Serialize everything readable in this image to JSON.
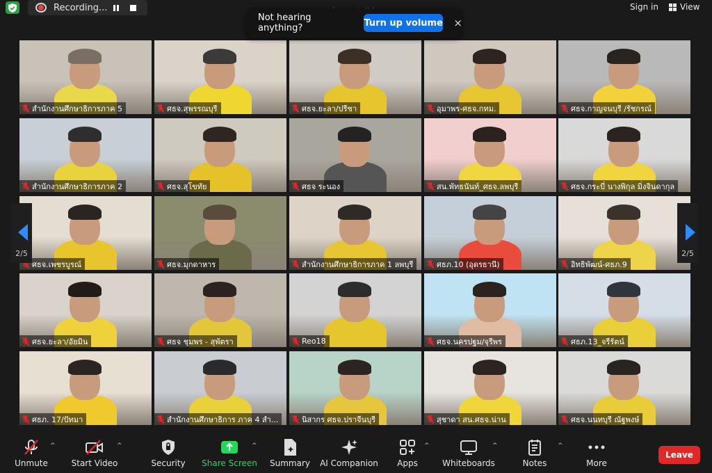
{
  "topbar": {
    "recording_label": "Recording...",
    "speaking_text": "กพร.สป.ศธ.ว. talking...",
    "signin_label": "Sign in",
    "view_label": "View"
  },
  "toast": {
    "message": "Not hearing anything?",
    "button_label": "Turn up volume",
    "close_glyph": "×"
  },
  "pager": {
    "left_page": "2/5",
    "right_page": "2/5"
  },
  "participants": [
    {
      "name": "สำนักงานศึกษาธิการภาค 5"
    },
    {
      "name": "ศธจ.สุพรรณบุรี"
    },
    {
      "name": "ศธจ.ยะลา/ปรีชา"
    },
    {
      "name": "อุมาพร-ศธจ.กทม."
    },
    {
      "name": "ศธจ.กาญจนบุรี /รัชกรณ์"
    },
    {
      "name": "สำนักงานศึกษาธิการภาค 2"
    },
    {
      "name": "ศธจ.สุโขทัย"
    },
    {
      "name": "ศธจ ระนอง"
    },
    {
      "name": "สน.พัทธนันท์_ศธจ.ลพบุรี"
    },
    {
      "name": "ศธจ.กระบี่ นางพิกุล มิ่งจินดากุล"
    },
    {
      "name": "ศธจ.เพชรบูรณ์"
    },
    {
      "name": "ศธจ.มุกดาหาร"
    },
    {
      "name": "สำนักงานศึกษาธิการภาค 1 ลพบุรี"
    },
    {
      "name": "ศธภ.10 (อุดรธานี)"
    },
    {
      "name": "อิทธิพัฒน์-ศธภ.9"
    },
    {
      "name": "ศธจ.ยะลา/อัยมิน"
    },
    {
      "name": "ศธจ ชุมพร - สุพัตรา"
    },
    {
      "name": "Reo18"
    },
    {
      "name": "ศธจ.นครปฐม/จุรีพร"
    },
    {
      "name": "ศธภ.13_จรีรัตน์"
    },
    {
      "name": "ศธภ. 17/ปัทมา"
    },
    {
      "name": "สำนักงานศึกษาธิการ ภาค 4 สำ..."
    },
    {
      "name": "นิสากร ศธจ.ปราจีนบุรี"
    },
    {
      "name": "สุชาดา สน.ศธจ.น่าน"
    },
    {
      "name": "ศธจ.นนทบุรี ณัฐพงษ์"
    }
  ],
  "toolbar": {
    "unmute": "Unmute",
    "start_video": "Start Video",
    "security": "Security",
    "share_screen": "Share Screen",
    "summary": "Summary",
    "ai_companion": "AI Companion",
    "apps": "Apps",
    "whiteboards": "Whiteboards",
    "notes": "Notes",
    "more": "More",
    "leave": "Leave"
  },
  "colors": {
    "accent": "#0e72ed",
    "share_green": "#23d959",
    "leave_red": "#e02828",
    "mute_red": "#e02828"
  }
}
